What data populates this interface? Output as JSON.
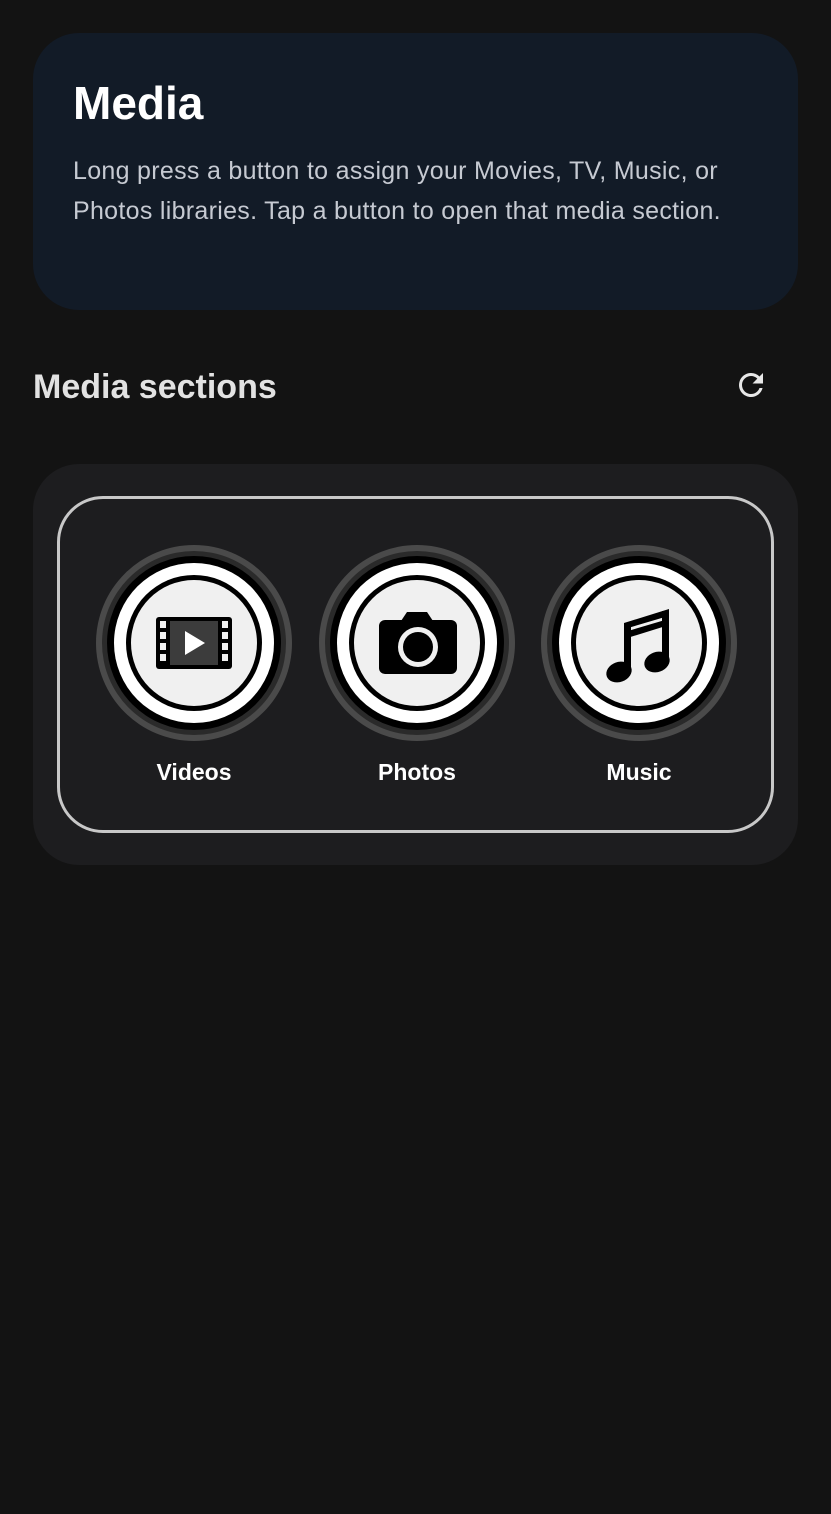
{
  "info": {
    "title": "Media",
    "description": "Long press a button to assign your Movies, TV, Music, or Photos libraries. Tap a button to open that media section."
  },
  "sections": {
    "title": "Media sections",
    "refresh_icon": "refresh-icon"
  },
  "tiles": [
    {
      "label": "Videos",
      "icon": "film-play-icon"
    },
    {
      "label": "Photos",
      "icon": "camera-icon"
    },
    {
      "label": "Music",
      "icon": "music-note-icon"
    }
  ],
  "colors": {
    "background": "#131313",
    "info_card": "#121b27",
    "panel": "#1d1d1f",
    "icon_face": "#f0f0f0"
  }
}
